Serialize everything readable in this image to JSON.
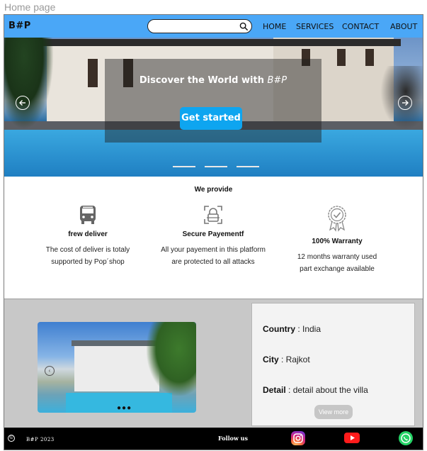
{
  "frame": {
    "label": "Home page"
  },
  "nav": {
    "brand": "B#P",
    "search": {
      "value": "",
      "placeholder": ""
    },
    "links": [
      "HOME",
      "SERVICES",
      "CONTACT",
      "ABOUT"
    ]
  },
  "hero": {
    "title": "Discover the World with",
    "title_brand": "B#P",
    "cta_label": "Get started",
    "active_slide": 2,
    "slide_count": 3
  },
  "provide": {
    "title": "We provide",
    "features": [
      {
        "icon": "bus-icon",
        "title": "frew deliver",
        "desc": [
          "The cost of deliver is totaly",
          "supported by Pop´shop"
        ]
      },
      {
        "icon": "secure-lock-icon",
        "title": "Secure Payementf",
        "desc": [
          "All your payement in this platform",
          "are protected to all attacks"
        ]
      },
      {
        "icon": "warranty-badge-icon",
        "title": "100% Warranty",
        "desc": [
          "12 months warranty  used",
          "part exchange available"
        ]
      }
    ]
  },
  "villa": {
    "country_label": "Country",
    "country_value": " : India",
    "city_label": "City",
    "city_value": " : Rajkot",
    "detail_label": "Detail",
    "detail_value": " : detail about the villa",
    "more_label": "View more",
    "image_dots": "●●●"
  },
  "footer": {
    "copyright_symbol": "©",
    "year_text": "B#P  2023",
    "follow_label": "Follow us",
    "social": [
      "instagram-icon",
      "youtube-icon",
      "whatsapp-icon"
    ]
  },
  "colors": {
    "nav_bg": "#4aa7f7",
    "cta_bg": "#0ea5f0",
    "footer_bg": "#000000",
    "villa_bg": "#c8c8c8"
  }
}
